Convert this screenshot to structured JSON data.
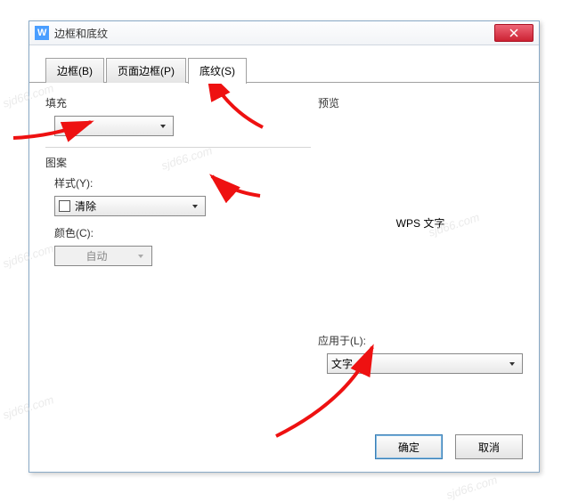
{
  "dialog": {
    "title": "边框和底纹"
  },
  "tabs": {
    "border": "边框(B)",
    "page_border": "页面边框(P)",
    "shading": "底纹(S)"
  },
  "left_panel": {
    "fill_label": "填充",
    "pattern_label": "图案",
    "style_label": "样式(Y):",
    "style_value": "清除",
    "color_label": "颜色(C):",
    "color_value": "自动"
  },
  "right_panel": {
    "preview_label": "预览",
    "preview_text": "WPS 文字",
    "apply_to_label": "应用于(L):",
    "apply_to_value": "文字"
  },
  "footer": {
    "ok": "确定",
    "cancel": "取消"
  },
  "watermark": "sjd66.com"
}
